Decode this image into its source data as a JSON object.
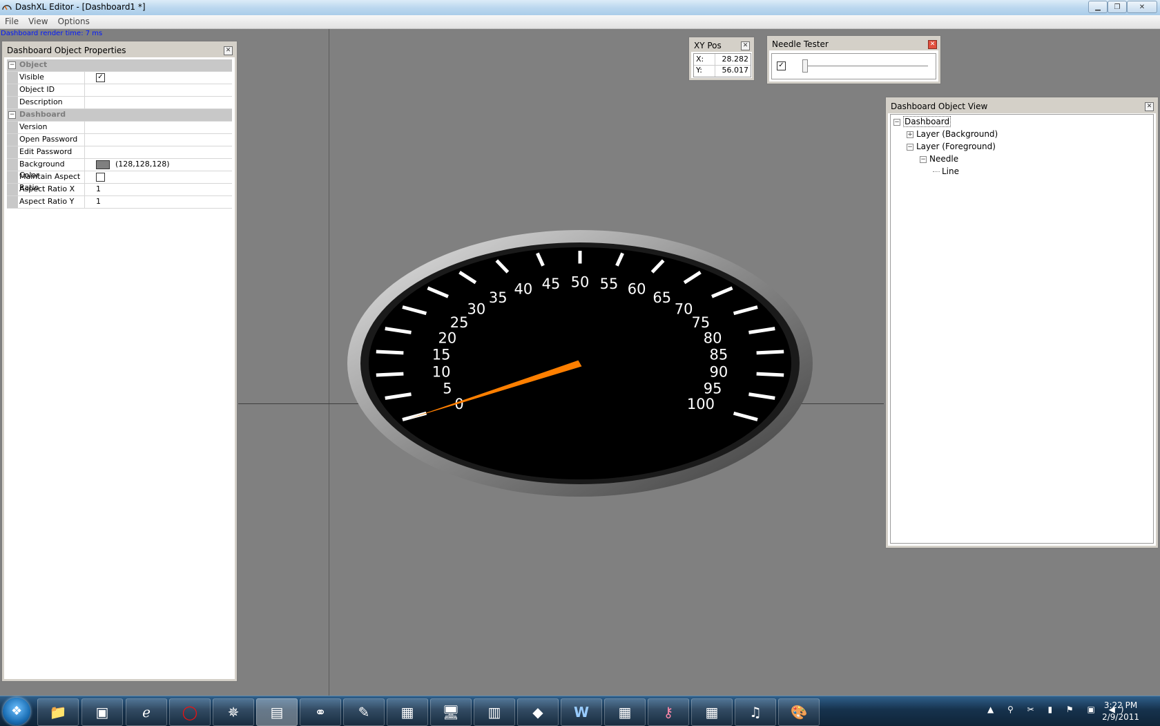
{
  "window": {
    "title": "DashXL Editor - [Dashboard1 *]"
  },
  "menu": [
    "File",
    "View",
    "Options"
  ],
  "render_time": "Dashboard render time: 7 ms",
  "properties_panel": {
    "title": "Dashboard Object Properties",
    "categories": [
      {
        "name": "Object",
        "rows": [
          {
            "name": "Visible",
            "value": "",
            "checked": true
          },
          {
            "name": "Object ID",
            "value": ""
          },
          {
            "name": "Description",
            "value": ""
          }
        ]
      },
      {
        "name": "Dashboard",
        "rows": [
          {
            "name": "Version",
            "value": ""
          },
          {
            "name": "Open Password",
            "value": ""
          },
          {
            "name": "Edit Password",
            "value": ""
          },
          {
            "name": "Background Color",
            "value": "(128,128,128)",
            "swatch": "#808080"
          },
          {
            "name": "Maintain Aspect Ratio",
            "value": "",
            "checked": false
          },
          {
            "name": "Aspect Ratio X",
            "value": "1"
          },
          {
            "name": "Aspect Ratio Y",
            "value": "1"
          }
        ]
      }
    ]
  },
  "xy_panel": {
    "title": "XY Pos",
    "x_label": "X:",
    "x_value": "28.282",
    "y_label": "Y:",
    "y_value": "56.017"
  },
  "needle_tester": {
    "title": "Needle Tester",
    "enabled": true,
    "slider_value": 0
  },
  "object_view": {
    "title": "Dashboard Object View",
    "tree": [
      {
        "label": "Dashboard",
        "depth": 0,
        "toggle": "−"
      },
      {
        "label": "Layer (Background)",
        "depth": 1,
        "toggle": "+"
      },
      {
        "label": "Layer (Foreground)",
        "depth": 1,
        "toggle": "−"
      },
      {
        "label": "Needle",
        "depth": 2,
        "toggle": "−"
      },
      {
        "label": "Line",
        "depth": 3,
        "toggle": ""
      }
    ]
  },
  "gauge": {
    "tick_labels": [
      "0",
      "5",
      "10",
      "15",
      "20",
      "25",
      "30",
      "35",
      "40",
      "45",
      "50",
      "55",
      "60",
      "65",
      "70",
      "75",
      "80",
      "85",
      "90",
      "95",
      "100"
    ],
    "needle_value": 0,
    "needle_color": "#ff7f00",
    "face_color": "#000000",
    "bezel_color": "#c0c0c0"
  },
  "taskbar": {
    "apps": [
      "folder-icon",
      "virtualbox-icon",
      "ie-icon",
      "opera-icon",
      "sc2-icon",
      "notepad-icon",
      "network-icon",
      "paint-icon",
      "dashxl-icon",
      "remote-icon",
      "task-icon",
      "app-icon",
      "word-icon",
      "dashxl-icon",
      "access-icon",
      "dashxl-icon",
      "itunes-icon",
      "paint-icon"
    ],
    "time": "3:22 PM",
    "date": "2/9/2011"
  }
}
